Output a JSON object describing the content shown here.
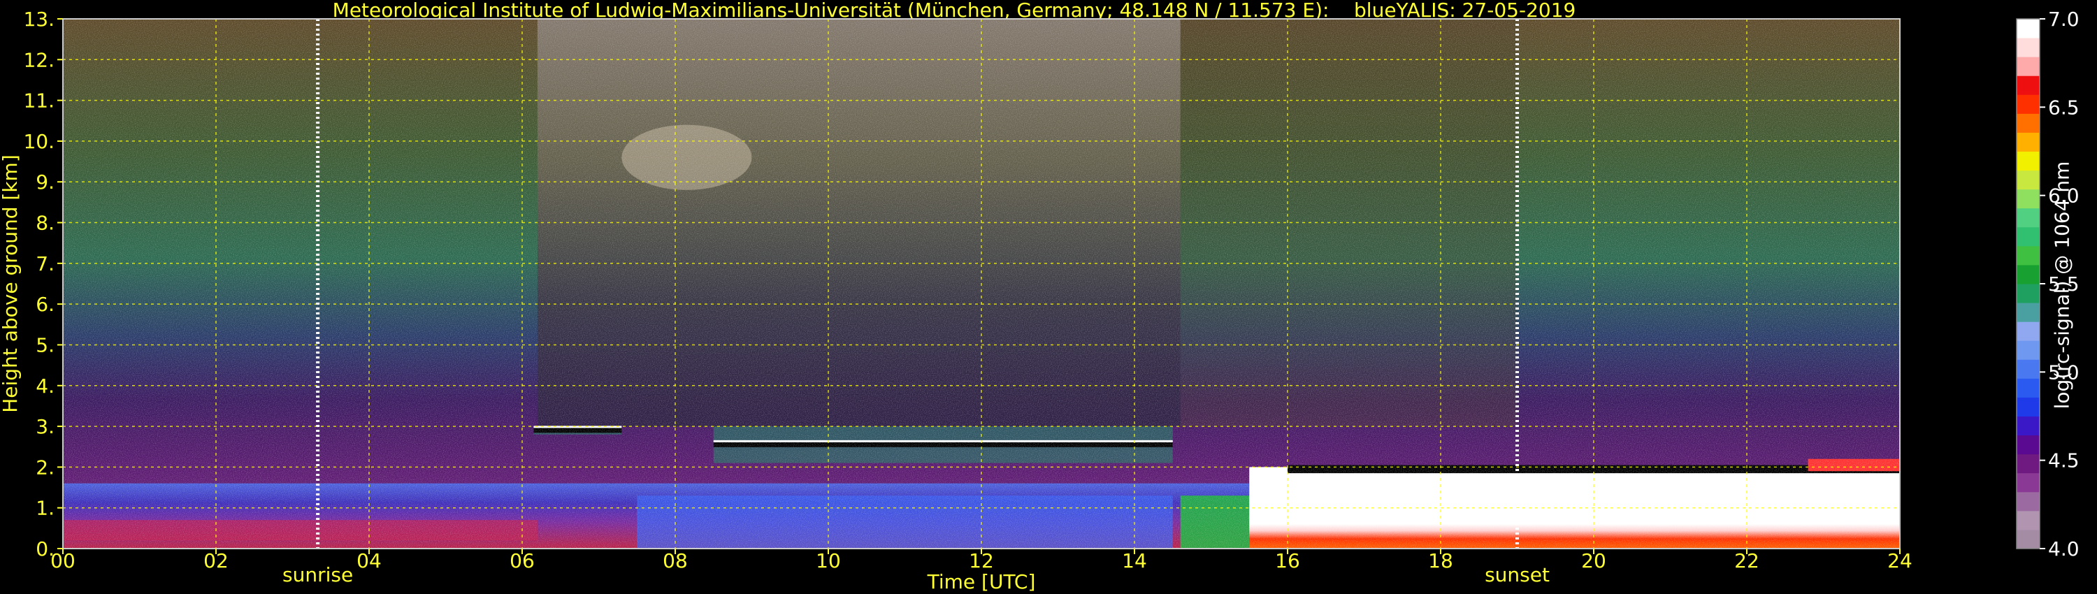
{
  "title": "Meteorological Institute of Ludwig-Maximilians-Universität (München, Germany; 48.148 N / 11.573 E):    blueYALIS: 27-05-2019",
  "colors": {
    "axis_text": "#ffff33",
    "grid": "#ffff00",
    "background": "#000000"
  },
  "chart_data": {
    "type": "heatmap",
    "xlabel": "Time [UTC]",
    "ylabel": "Height above ground [km]",
    "xlim": [
      0,
      24
    ],
    "ylim": [
      0,
      13
    ],
    "xticks": [
      0,
      2,
      4,
      6,
      8,
      10,
      12,
      14,
      16,
      18,
      20,
      22,
      24
    ],
    "xtick_labels": [
      "00",
      "02",
      "04",
      "06",
      "08",
      "10",
      "12",
      "14",
      "16",
      "18",
      "20",
      "22",
      "24"
    ],
    "yticks": [
      0,
      1,
      2,
      3,
      4,
      5,
      6,
      7,
      8,
      9,
      10,
      11,
      12,
      13
    ],
    "ytick_labels": [
      "0.",
      "1.",
      "2.",
      "3.",
      "4.",
      "5.",
      "6.",
      "7.",
      "8.",
      "9.",
      "10.",
      "11.",
      "12.",
      "13."
    ],
    "grid": true,
    "annotations": [
      {
        "label": "sunrise",
        "time": 3.33
      },
      {
        "label": "sunset",
        "time": 19.0
      }
    ],
    "colorbar": {
      "label": "log(rc-signal) @ 1064 nm",
      "range": [
        4.0,
        7.0
      ],
      "ticks": [
        "4.0",
        "4.5",
        "5.0",
        "5.5",
        "6.0",
        "6.5",
        "7.0"
      ],
      "colors": [
        "#a58ca5",
        "#b094b0",
        "#9a6aa0",
        "#8a3a95",
        "#6e1a80",
        "#5a0a90",
        "#3a18c8",
        "#1f3ae8",
        "#2a5af0",
        "#4a78f0",
        "#6f98f0",
        "#90a8f0",
        "#4aa0a0",
        "#20a060",
        "#18a030",
        "#40c040",
        "#30c070",
        "#50d080",
        "#90e060",
        "#c8e840",
        "#f0f000",
        "#ffb000",
        "#ff7000",
        "#ff3000",
        "#ee1010",
        "#ffaaaa",
        "#ffdddd",
        "#ffffff"
      ]
    },
    "features": [
      {
        "name": "cloud-layer-morning",
        "x": [
          6.15,
          7.3
        ],
        "y": [
          2.8,
          3.0
        ]
      },
      {
        "name": "cirrus",
        "x": [
          7.3,
          9.0
        ],
        "y": [
          8.8,
          10.4
        ]
      },
      {
        "name": "cloud-layer-midday",
        "x": [
          8.5,
          14.5
        ],
        "y": [
          2.1,
          3.0
        ]
      },
      {
        "name": "convective-boundary-layer",
        "x": [
          15.5,
          24.0
        ],
        "y": [
          0.0,
          2.0
        ]
      }
    ]
  }
}
